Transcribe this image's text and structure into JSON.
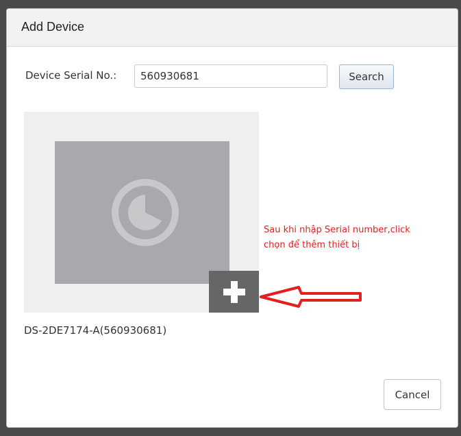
{
  "dialog": {
    "title": "Add Device",
    "serial_label": "Device Serial No.:",
    "serial_value": "560930681",
    "search_label": "Search",
    "cancel_label": "Cancel"
  },
  "device": {
    "name": "DS-2DE7174-A(560930681)",
    "thumbnail_icon": "camera-placeholder-icon",
    "add_icon": "plus-icon"
  },
  "annotation": {
    "line1": "Sau khi nhập Serial number,click",
    "line2": "chọn để thêm thiết bị",
    "color": "#e12020",
    "arrow_icon": "left-arrow-icon"
  }
}
